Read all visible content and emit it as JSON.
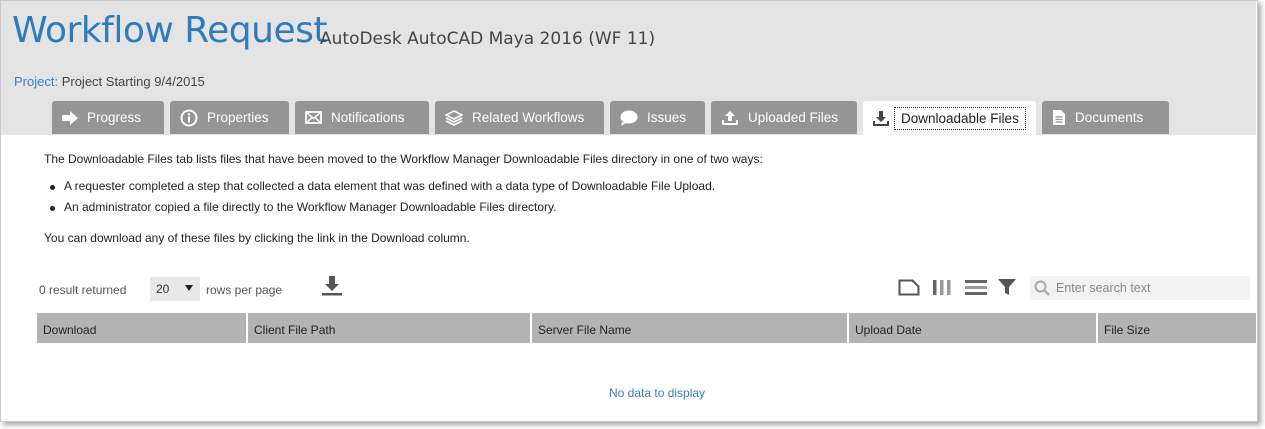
{
  "header": {
    "title": "Workflow Request",
    "subtitle": "AutoDesk AutoCAD Maya 2016 (WF 11)",
    "project_label": "Project:",
    "project_value": "Project Starting 9/4/2015"
  },
  "tabs": [
    {
      "label": "Progress",
      "icon": "arrow-right-icon"
    },
    {
      "label": "Properties",
      "icon": "info-icon"
    },
    {
      "label": "Notifications",
      "icon": "envelope-icon"
    },
    {
      "label": "Related Workflows",
      "icon": "layers-icon"
    },
    {
      "label": "Issues",
      "icon": "speech-bubble-icon"
    },
    {
      "label": "Uploaded Files",
      "icon": "upload-icon"
    },
    {
      "label": "Downloadable Files",
      "icon": "download-icon",
      "active": true
    },
    {
      "label": "Documents",
      "icon": "document-icon"
    }
  ],
  "content": {
    "intro": "The Downloadable Files tab lists files that have been moved to the Workflow Manager Downloadable Files directory in one of two ways:",
    "bullets": [
      "A requester completed a step that collected a data element that was defined with a data type of Downloadable File Upload.",
      "An administrator copied a file directly to the Workflow Manager Downloadable Files directory."
    ],
    "outro": "You can download any of these files by clicking the link in the Download column."
  },
  "grid": {
    "result_text": "0 result returned",
    "rows_per_page_value": "20",
    "rows_per_page_label": "rows per page",
    "search_placeholder": "Enter search text",
    "columns": [
      "Download",
      "Client File Path",
      "Server File Name",
      "Upload Date",
      "File Size"
    ],
    "empty_text": "No data to display"
  },
  "colors": {
    "accent": "#2f7bbd",
    "tab_bg": "#959595",
    "header_bg": "#e4e4e4",
    "table_header_bg": "#b3b3b3"
  }
}
